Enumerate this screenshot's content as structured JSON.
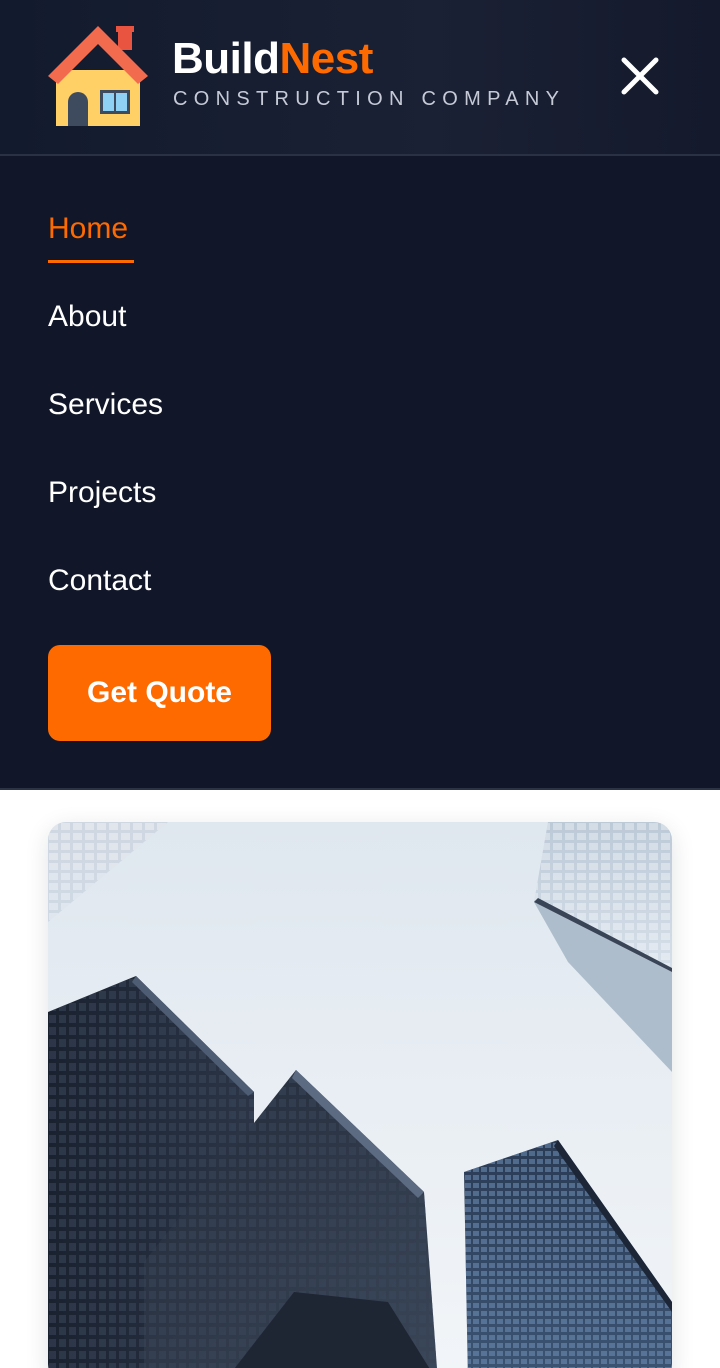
{
  "header": {
    "brand_part1": "Build",
    "brand_part2": "Nest",
    "tagline": "CONSTRUCTION COMPANY",
    "logo_icon": "house-icon",
    "close_icon": "close-icon"
  },
  "nav": {
    "items": [
      {
        "label": "Home",
        "active": true
      },
      {
        "label": "About",
        "active": false
      },
      {
        "label": "Services",
        "active": false
      },
      {
        "label": "Projects",
        "active": false
      },
      {
        "label": "Contact",
        "active": false
      }
    ],
    "cta_label": "Get Quote"
  },
  "hero": {
    "image": "skyscrapers-photo"
  },
  "colors": {
    "accent": "#ff6a00",
    "header_bg": "#161c2f",
    "menu_bg": "#111729",
    "text": "#ffffff",
    "tagline": "#c5cad6"
  }
}
